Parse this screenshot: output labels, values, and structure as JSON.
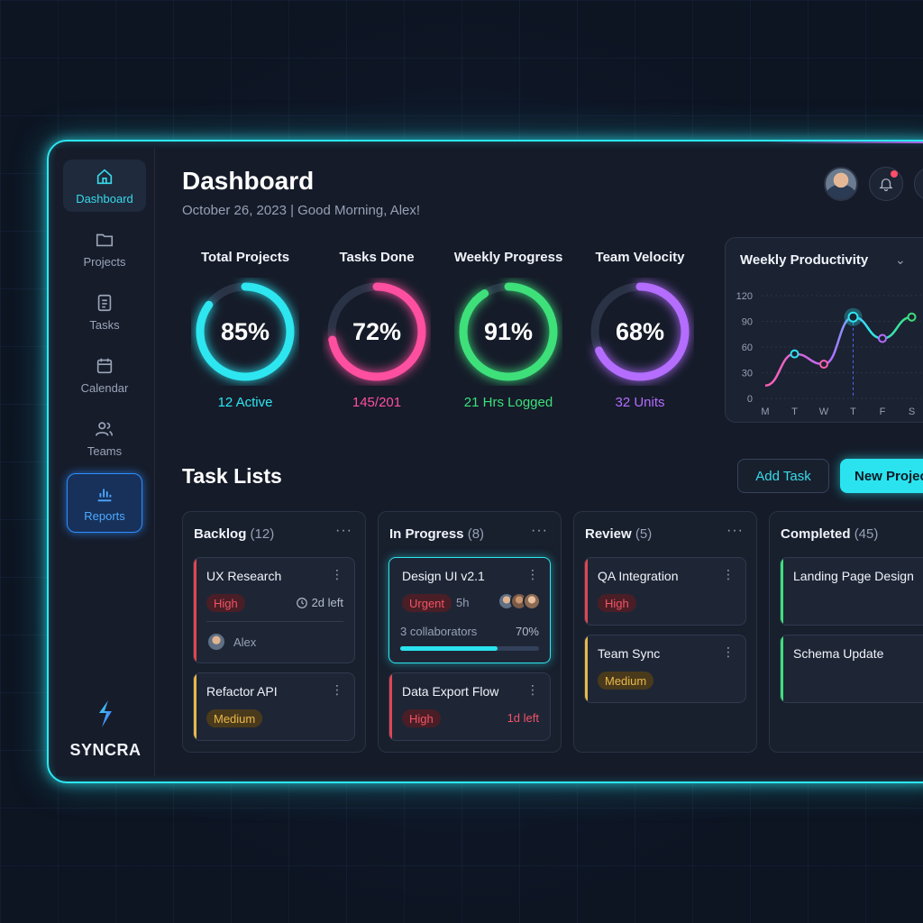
{
  "colors": {
    "cyan": "#2de6f0",
    "pink": "#ff4fa0",
    "green": "#3ee07a",
    "purple": "#b46dff",
    "red": "#e2454f",
    "yellow": "#e8b84a"
  },
  "sidebar": {
    "items": [
      {
        "label": "Dashboard",
        "icon": "home-icon",
        "active": true
      },
      {
        "label": "Projects",
        "icon": "folder-icon"
      },
      {
        "label": "Tasks",
        "icon": "tasks-icon"
      },
      {
        "label": "Calendar",
        "icon": "calendar-icon"
      },
      {
        "label": "Teams",
        "icon": "users-icon"
      },
      {
        "label": "Reports",
        "icon": "bar-chart-icon"
      }
    ],
    "brand": "SYNCRA"
  },
  "header": {
    "title": "Dashboard",
    "subtitle": "October 26, 2023 | Good Morning, Alex!"
  },
  "metrics": [
    {
      "label": "Total Projects",
      "value": "85%",
      "percent": 85,
      "sub": "12 Active",
      "color": "#2de6f0"
    },
    {
      "label": "Tasks Done",
      "value": "72%",
      "percent": 72,
      "sub": "145/201",
      "color": "#ff4fa0"
    },
    {
      "label": "Weekly Progress",
      "value": "91%",
      "percent": 91,
      "sub": "21 Hrs Logged",
      "color": "#3ee07a"
    },
    {
      "label": "Team Velocity",
      "value": "68%",
      "percent": 68,
      "sub": "32 Units",
      "color": "#b46dff"
    }
  ],
  "productivity": {
    "title": "Weekly Productivity",
    "chart_data": {
      "type": "line",
      "title": "Weekly Productivity",
      "categories": [
        "M",
        "T",
        "W",
        "T",
        "F",
        "S"
      ],
      "values": [
        15,
        52,
        40,
        95,
        70,
        95
      ],
      "yticks": [
        0,
        30,
        60,
        90,
        120
      ],
      "ylim": [
        0,
        120
      ]
    }
  },
  "tasks": {
    "title": "Task Lists",
    "add_label": "Add Task",
    "new_label": "New Project",
    "columns": [
      {
        "name": "Backlog",
        "count": "(12)",
        "cards": [
          {
            "title": "UX Research",
            "tag": "High",
            "due": "2d left",
            "assignee": "Alex"
          },
          {
            "title": "Refactor API",
            "tag": "Medium"
          }
        ]
      },
      {
        "name": "In Progress",
        "count": "(8)",
        "cards": [
          {
            "title": "Design UI v2.1",
            "tag": "Urgent",
            "time": "5h",
            "collaborators": "3 collaborators",
            "progress": "70%",
            "progress_value": 0.7
          },
          {
            "title": "Data Export Flow",
            "tag": "High",
            "due": "1d left"
          }
        ]
      },
      {
        "name": "Review",
        "count": "(5)",
        "cards": [
          {
            "title": "QA Integration",
            "tag": "High"
          },
          {
            "title": "Team Sync",
            "tag": "Medium"
          }
        ]
      },
      {
        "name": "Completed",
        "count": "(45)",
        "cards": [
          {
            "title": "Landing Page Design"
          },
          {
            "title": "Schema Update"
          }
        ]
      }
    ]
  }
}
